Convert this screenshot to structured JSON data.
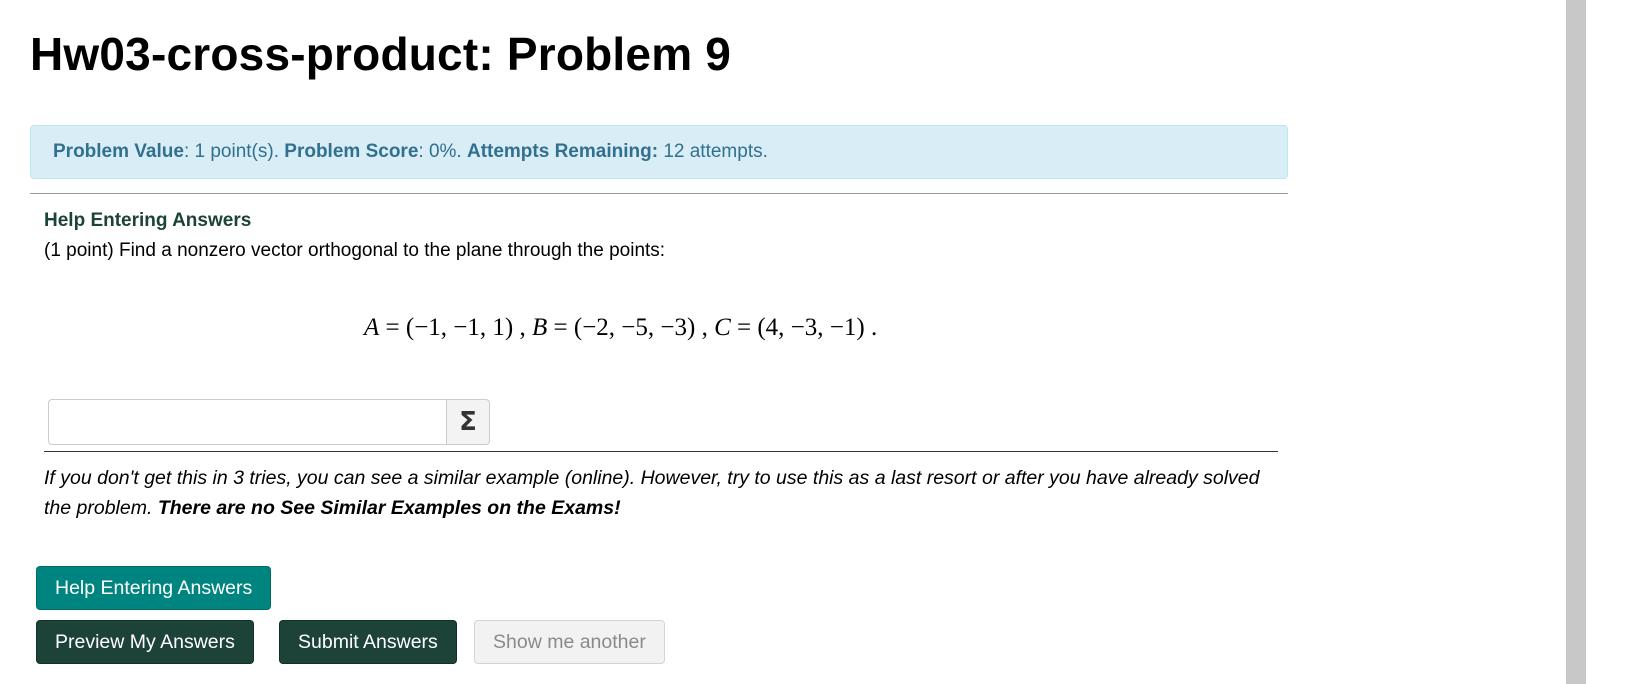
{
  "page": {
    "title": "Hw03-cross-product: Problem 9"
  },
  "info": {
    "value_label": "Problem Value",
    "value_text": ": 1 point(s). ",
    "score_label": "Problem Score",
    "score_text": ": 0%. ",
    "attempts_label": "Attempts Remaining:",
    "attempts_text": " 12 attempts."
  },
  "problem": {
    "help_link": "Help Entering Answers",
    "statement": "(1 point) Find a nonzero vector orthogonal to the plane through the points:",
    "math": {
      "a_var": "A",
      "a_val": " = (−1, −1, 1) , ",
      "b_var": "B",
      "b_val": " = (−2, −5, −3) , ",
      "c_var": "C",
      "c_val": " = (4, −3, −1) ."
    },
    "answer_value": "",
    "sigma_glyph": "Σ",
    "note_italic": "If you don't get this in 3 tries, you can see a similar example (online). However, try to use this as a last resort or after you have already solved the problem. ",
    "note_bold": "There are no See Similar Examples on the Exams!"
  },
  "buttons": {
    "help": "Help Entering Answers",
    "preview": "Preview My Answers",
    "submit": "Submit Answers",
    "another": "Show me another"
  },
  "colors": {
    "info_bg": "#d9edf7",
    "info_text": "#31708f",
    "teal_button": "#00847f",
    "dark_green_button": "#1d4339",
    "disabled_button": "#f2f2f2"
  }
}
